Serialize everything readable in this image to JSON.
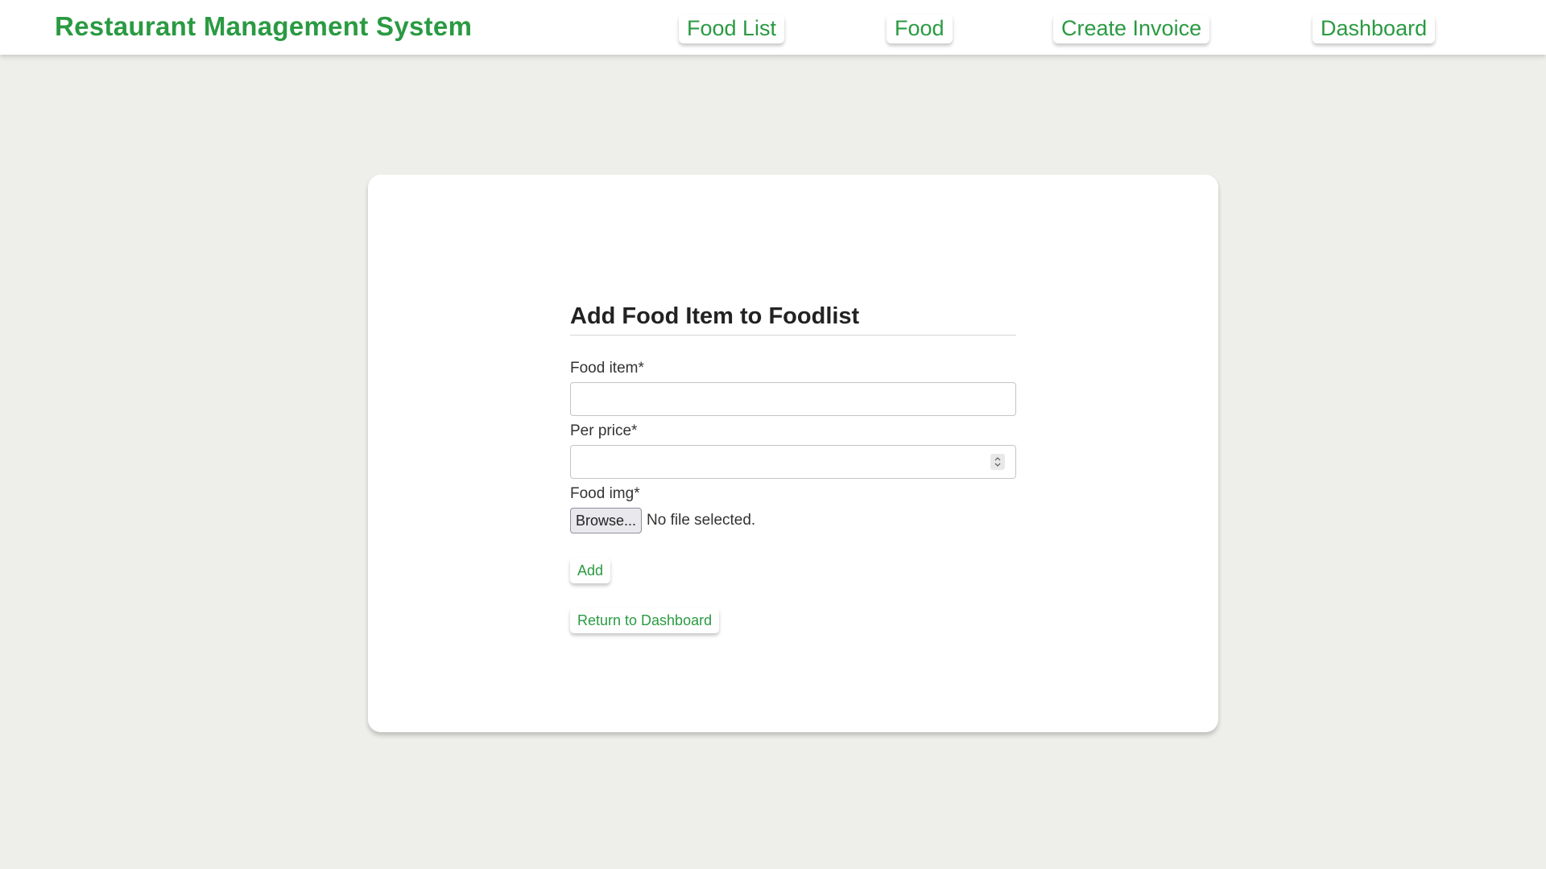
{
  "navbar": {
    "brand": "Restaurant Management System",
    "links": [
      {
        "label": "Food List"
      },
      {
        "label": "Food"
      },
      {
        "label": "Create Invoice"
      },
      {
        "label": "Dashboard"
      }
    ]
  },
  "form": {
    "title": "Add Food Item to Foodlist",
    "food_item_label": "Food item*",
    "food_item_value": "",
    "per_price_label": "Per price*",
    "per_price_value": "",
    "food_img_label": "Food img*",
    "browse_label": "Browse...",
    "file_status": "No file selected.",
    "add_label": "Add",
    "return_label": "Return to Dashboard"
  },
  "icons": {
    "spinner": "number-spinner-icon"
  },
  "colors": {
    "accent": "#2a9a42",
    "background": "#eeeeea",
    "card": "#ffffff"
  }
}
